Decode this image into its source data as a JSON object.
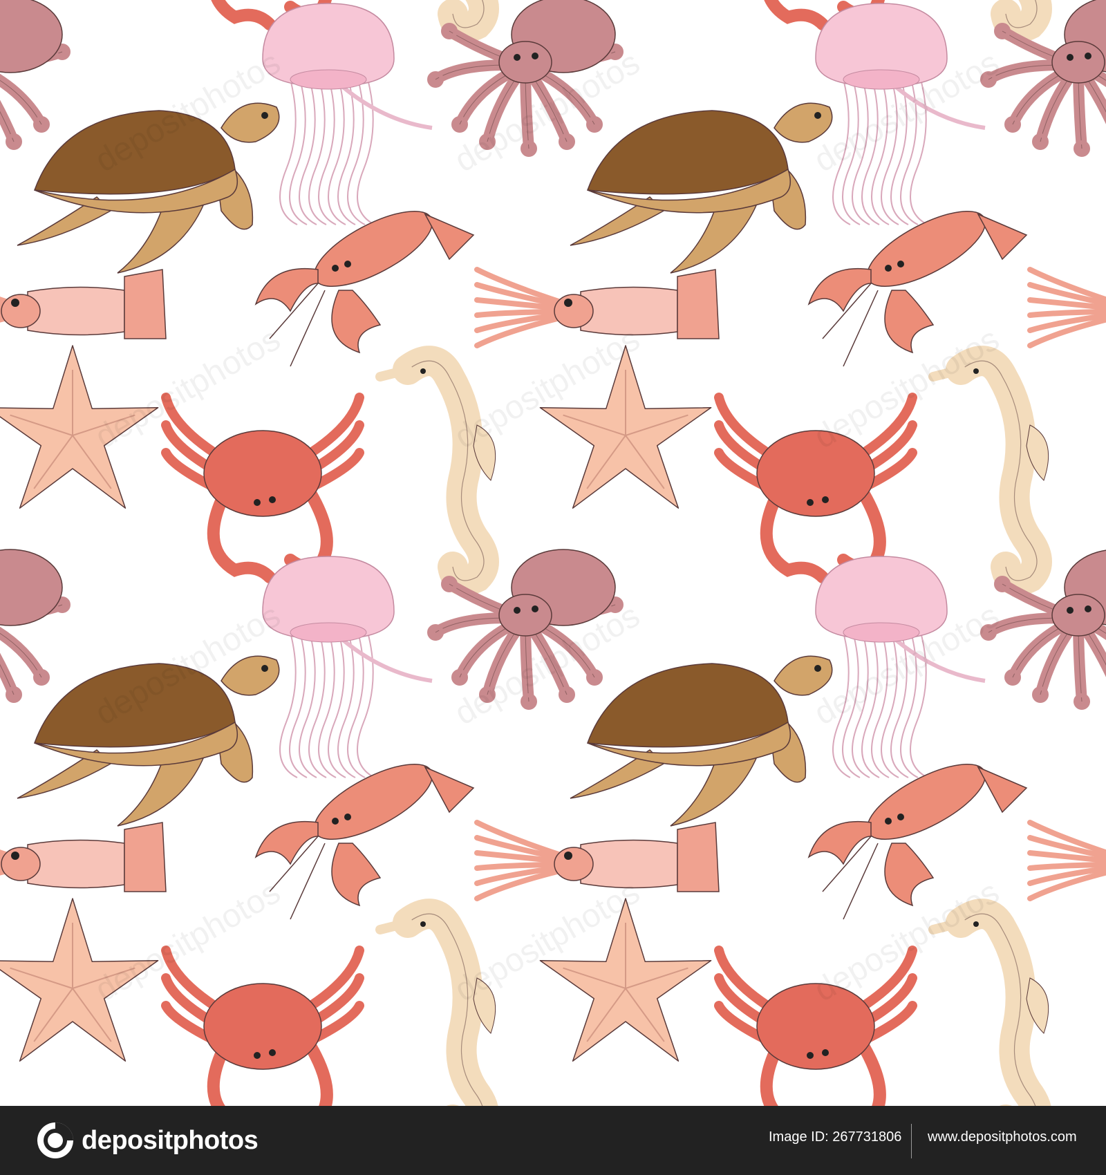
{
  "background_color": "#ffffff",
  "footer": {
    "brand_name": "depositphotos",
    "image_id_label": "Image ID:",
    "image_id": "267731806",
    "site_url": "www.depositphotos.com",
    "background": "#222222"
  },
  "watermark_text": "depositphotos",
  "pattern": {
    "creatures": [
      "octopus",
      "jellyfish",
      "sea-turtle",
      "lobster",
      "squid",
      "starfish",
      "crab",
      "seahorse"
    ],
    "colors": {
      "octopus": "#c98a8e",
      "jellyfish": "#f7c6d6",
      "turtle_shell": "#8a5a2b",
      "turtle_skin": "#d2a46a",
      "lobster": "#ec8d78",
      "squid": "#f0a290",
      "starfish": "#f7c2a8",
      "crab": "#e36b5c",
      "seahorse": "#f3dcbc"
    }
  }
}
